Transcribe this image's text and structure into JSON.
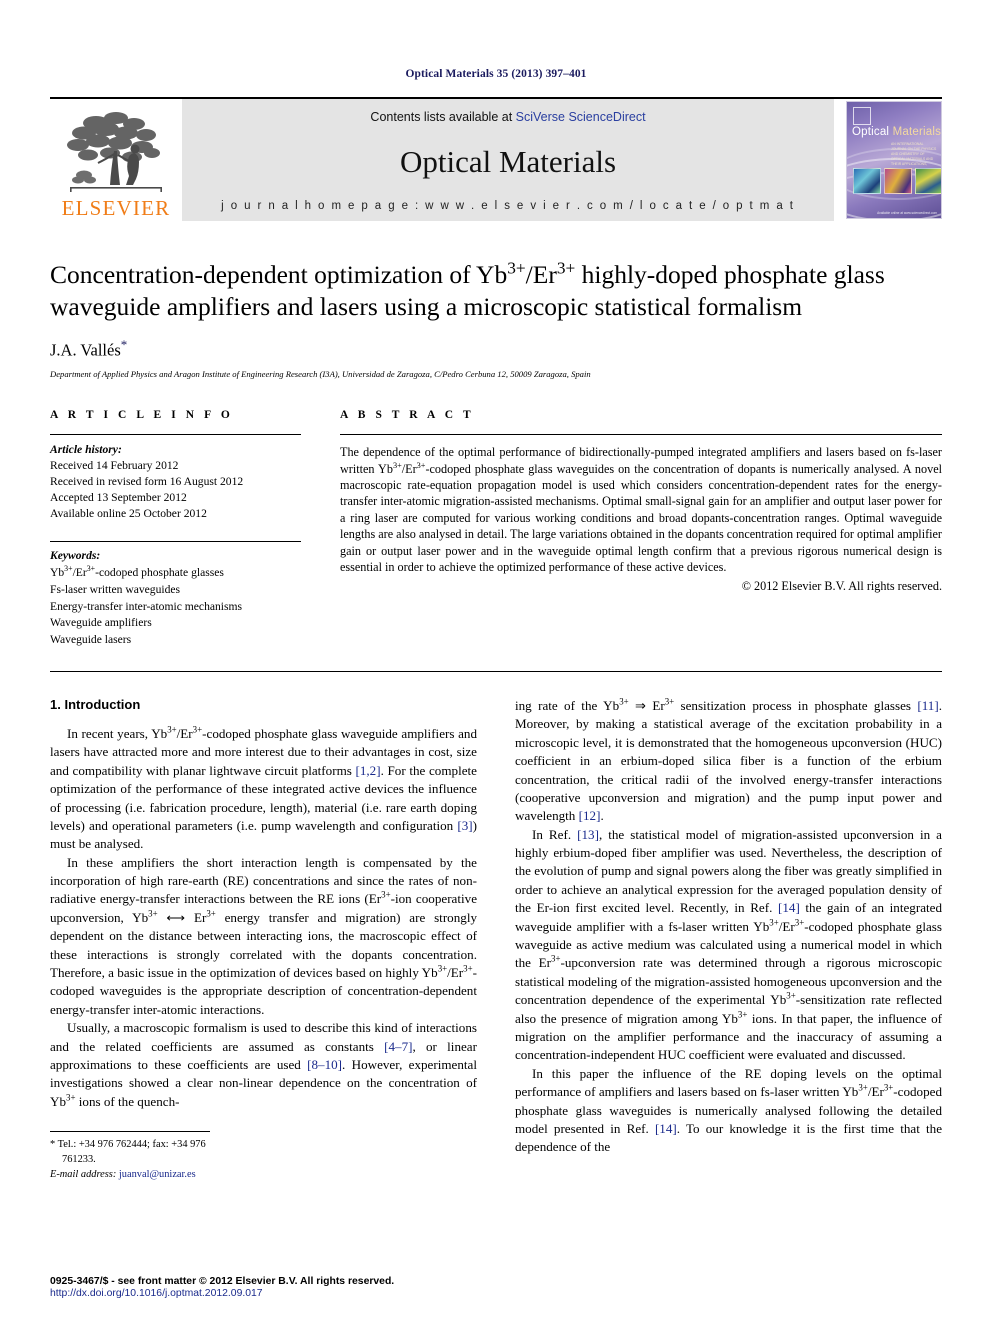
{
  "running_head": "Optical Materials 35 (2013) 397–401",
  "banner": {
    "publisher_logo_text": "ELSEVIER",
    "contents_prefix": "Contents lists available at ",
    "contents_link": "SciVerse ScienceDirect",
    "journal_name": "Optical Materials",
    "homepage_line": "j o u r n a l   h o m e p a g e :   w w w . e l s e v i e r . c o m / l o c a t e / o p t m a t",
    "cover": {
      "title_word1": "Optical",
      "title_word2": "Materials",
      "subtitle": "AN INTERNATIONAL JOURNAL ON THE PHYSICS AND CHEMISTRY OF OPTICAL MATERIALS AND THEIR APPLICATIONS, INCLUDING PHOTONICS",
      "footer": "Available online at www.sciencedirect.com"
    }
  },
  "title_block": {
    "title_line1_pre": "Concentration-dependent optimization of Yb",
    "title_sup1": "3+",
    "title_mid1": "/Er",
    "title_sup2": "3+",
    "title_line1_post": " highly-doped phosphate",
    "title_line2": "glass waveguide amplifiers and lasers using a microscopic statistical formalism",
    "author": "J.A. Vallés",
    "author_marker": "*",
    "affiliation": "Department of Applied Physics and Aragon Institute of Engineering Research (I3A), Universidad de Zaragoza, C/Pedro Cerbuna 12, 50009 Zaragoza, Spain"
  },
  "article_info": {
    "label": "A R T I C L E  I N F O",
    "history_title": "Article history:",
    "history": [
      "Received 14 February 2012",
      "Received in revised form 16 August 2012",
      "Accepted 13 September 2012",
      "Available online 25 October 2012"
    ],
    "keywords_title": "Keywords:",
    "keywords": [
      "Yb3+/Er3+-codoped phosphate glasses",
      "Fs-laser written waveguides",
      "Energy-transfer inter-atomic mechanisms",
      "Waveguide amplifiers",
      "Waveguide lasers"
    ]
  },
  "abstract": {
    "label": "A B S T R A C T",
    "text": "The dependence of the optimal performance of bidirectionally-pumped integrated amplifiers and lasers based on fs-laser written Yb3+/Er3+-codoped phosphate glass waveguides on the concentration of dopants is numerically analysed. A novel macroscopic rate-equation propagation model is used which considers concentration-dependent rates for the energy-transfer inter-atomic migration-assisted mechanisms. Optimal small-signal gain for an amplifier and output laser power for a ring laser are computed for various working conditions and broad dopants-concentration ranges. Optimal waveguide lengths are also analysed in detail. The large variations obtained in the dopants concentration required for optimal amplifier gain or output laser power and in the waveguide optimal length confirm that a previous rigorous numerical design is essential in order to achieve the optimized performance of these active devices.",
    "copyright": "© 2012 Elsevier B.V. All rights reserved."
  },
  "body": {
    "section_heading": "1. Introduction",
    "para1": "In recent years, Yb3+/Er3+-codoped phosphate glass waveguide amplifiers and lasers have attracted more and more interest due to their advantages in cost, size and compatibility with planar lightwave circuit platforms [1,2]. For the complete optimization of the performance of these integrated active devices the influence of processing (i.e. fabrication procedure, length), material (i.e. rare earth doping levels) and operational parameters (i.e. pump wavelength and configuration [3]) must be analysed.",
    "para2": "In these amplifiers the short interaction length is compensated by the incorporation of high rare-earth (RE) concentrations and since the rates of non-radiative energy-transfer interactions between the RE ions (Er3+-ion cooperative upconversion, Yb3+ ⟺ Er3+ energy transfer and migration) are strongly dependent on the distance between interacting ions, the macroscopic effect of these interactions is strongly correlated with the dopants concentration. Therefore, a basic issue in the optimization of devices based on highly Yb3+/Er3+-codoped waveguides is the appropriate description of concentration-dependent energy-transfer inter-atomic interactions.",
    "para3": "Usually, a macroscopic formalism is used to describe this kind of interactions and the related coefficients are assumed as constants [4–7], or linear approximations to these coefficients are used [8–10]. However, experimental investigations showed a clear non-linear dependence on the concentration of Yb3+ ions of the quench-",
    "para4": "ing rate of the Yb3+ ⇒ Er3+ sensitization process in phosphate glasses [11]. Moreover, by making a statistical average of the excitation probability in a microscopic level, it is demonstrated that the homogeneous upconversion (HUC) coefficient in an erbium-doped silica fiber is a function of the erbium concentration, the critical radii of the involved energy-transfer interactions (cooperative upconversion and migration) and the pump input power and wavelength [12].",
    "para5": "In Ref. [13], the statistical model of migration-assisted upconversion in a highly erbium-doped fiber amplifier was used. Nevertheless, the description of the evolution of pump and signal powers along the fiber was greatly simplified in order to achieve an analytical expression for the averaged population density of the Er-ion first excited level. Recently, in Ref. [14] the gain of an integrated waveguide amplifier with a fs-laser written Yb3+/Er3+-codoped phosphate glass waveguide as active medium was calculated using a numerical model in which the Er3+-upconversion rate was determined through a rigorous microscopic statistical modeling of the migration-assisted homogeneous upconversion and the concentration dependence of the experimental Yb3+-sensitization rate reflected also the presence of migration among Yb3+ ions. In that paper, the influence of migration on the amplifier performance and the inaccuracy of assuming a concentration-independent HUC coefficient were evaluated and discussed.",
    "para6": "In this paper the influence of the RE doping levels on the optimal performance of amplifiers and lasers based on fs-laser written Yb3+/Er3+-codoped phosphate glass waveguides is numerically analysed following the detailed model presented in Ref. [14]. To our knowledge it is the first time that the dependence of the"
  },
  "footnote": {
    "marker": "*",
    "tel": "Tel.: +34 976 762444; fax: +34 976 761233.",
    "email_label": "E-mail address:",
    "email": "juanval@unizar.es"
  },
  "page_footer": {
    "issn": "0925-3467/$ - see front matter © 2012 Elsevier B.V. All rights reserved.",
    "doi": "http://dx.doi.org/10.1016/j.optmat.2012.09.017"
  },
  "colors": {
    "link": "#1a2a8c",
    "elsevier_orange": "#F07D18",
    "running_head": "#1a1a5e"
  }
}
